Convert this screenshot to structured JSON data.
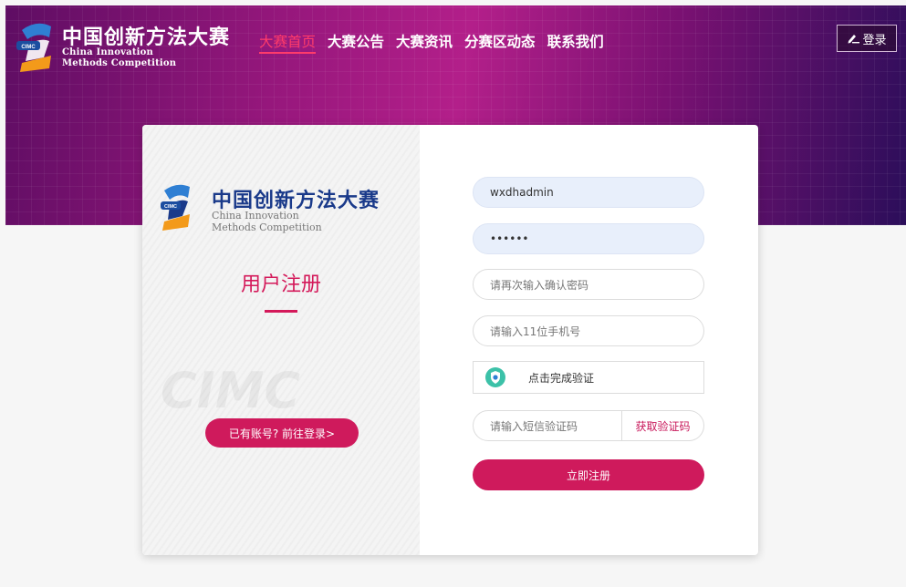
{
  "header": {
    "logo": {
      "badge": "CIMC",
      "cn": "中国创新方法大赛",
      "en_line1": "China Innovation",
      "en_line2": "Methods Competition"
    },
    "nav": [
      "大赛首页",
      "大赛公告",
      "大赛资讯",
      "分赛区动态",
      "联系我们"
    ],
    "active_nav": "大赛首页",
    "login_label": "登录"
  },
  "left_panel": {
    "logo": {
      "badge": "CIMC",
      "cn": "中国创新方法大赛",
      "en_line1": "China Innovation",
      "en_line2": "Methods Competition"
    },
    "watermark": "CIMC",
    "title": "用户注册",
    "to_login_label": "已有账号? 前往登录>"
  },
  "form": {
    "username_value": "wxdhadmin",
    "password_mask": "••••••",
    "confirm_password_placeholder": "请再次输入确认密码",
    "phone_placeholder": "请输入11位手机号",
    "captcha_label": "点击完成验证",
    "sms_placeholder": "请输入短信验证码",
    "get_code_label": "获取验证码",
    "submit_label": "立即注册"
  },
  "colors": {
    "brand_pink": "#cf1a5c",
    "nav_active": "#ff3b6a",
    "band_purple": "#96177c",
    "logo_blue": "#1a3a8a"
  }
}
